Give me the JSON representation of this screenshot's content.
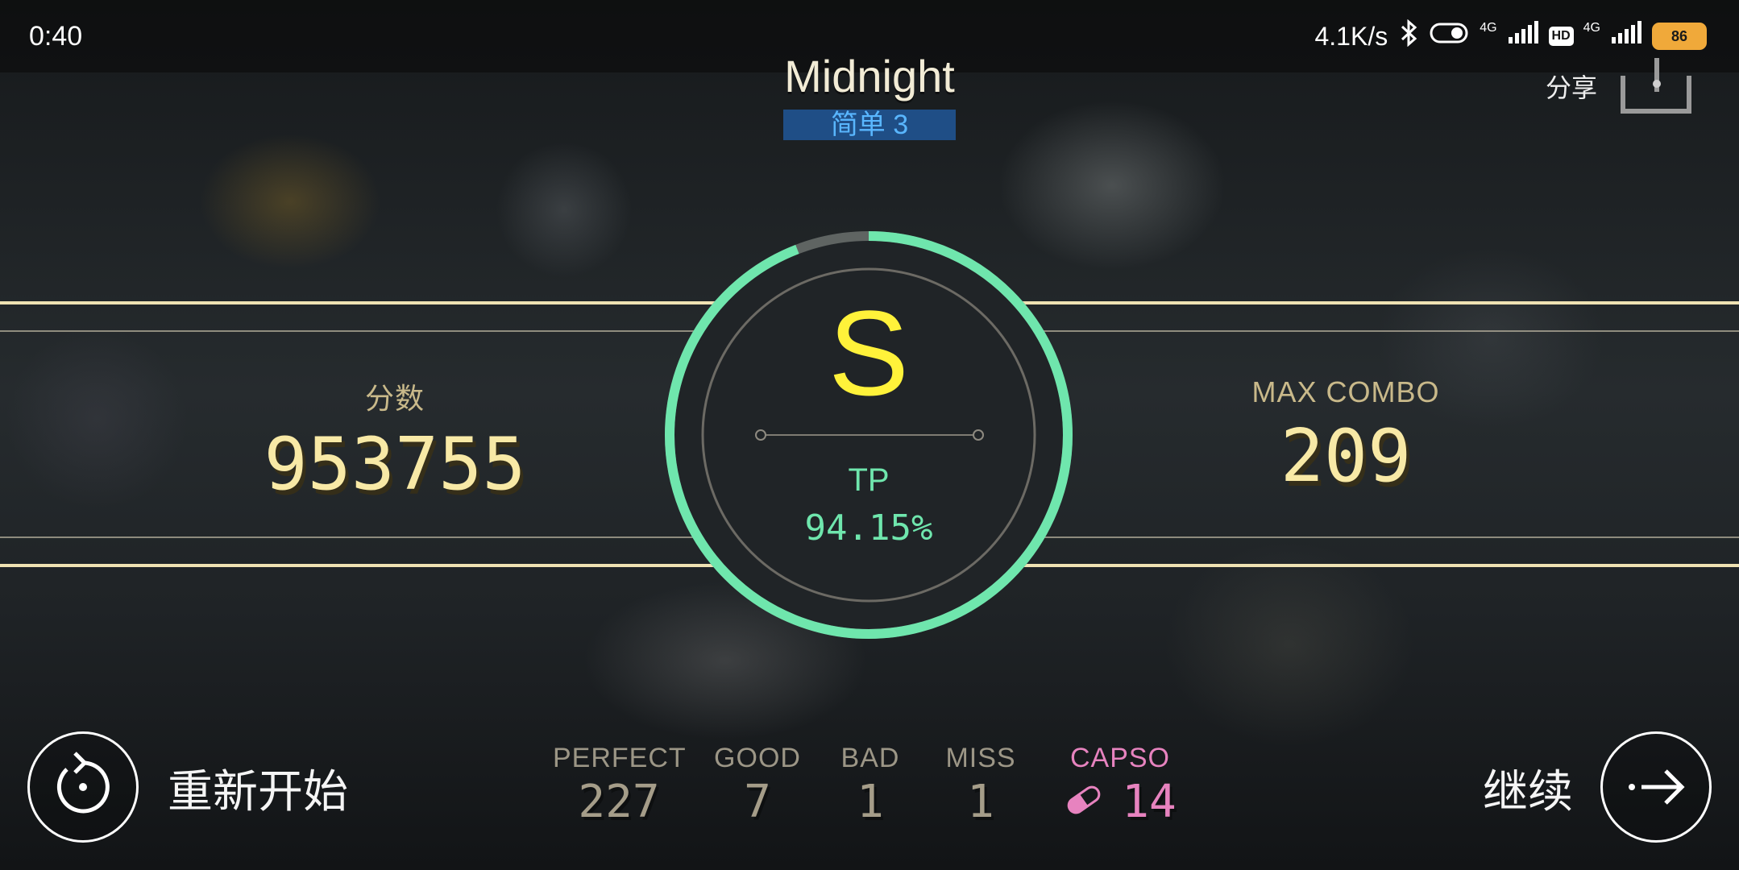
{
  "status_bar": {
    "time": "0:40",
    "net_speed": "4.1K/s",
    "net1": "4G",
    "hd": "HD",
    "net2": "4G",
    "battery": "86"
  },
  "song": {
    "title": "Midnight",
    "difficulty": "简单 3"
  },
  "share": {
    "label": "分享",
    "icon": "share-icon"
  },
  "score": {
    "label": "分数",
    "value": "953755"
  },
  "max_combo": {
    "label": "MAX COMBO",
    "value": "209"
  },
  "result": {
    "rank": "S",
    "tp_label": "TP",
    "tp_value": "94.15%",
    "tp_fraction": 0.9415
  },
  "judgements": [
    {
      "label": "PERFECT",
      "value": "227"
    },
    {
      "label": "GOOD",
      "value": "7"
    },
    {
      "label": "BAD",
      "value": "1"
    },
    {
      "label": "MISS",
      "value": "1"
    }
  ],
  "capso": {
    "label": "CAPSO",
    "value": "14",
    "icon": "capsule-icon"
  },
  "buttons": {
    "restart_label": "重新开始",
    "continue_label": "继续"
  },
  "colors": {
    "accent_green": "#6fe6ad",
    "rank_yellow": "#fff23a",
    "score_gold": "#f8e9a6",
    "capso_pink": "#e783bf",
    "difficulty_bg": "#1f4e86",
    "difficulty_text": "#59b6ff"
  }
}
